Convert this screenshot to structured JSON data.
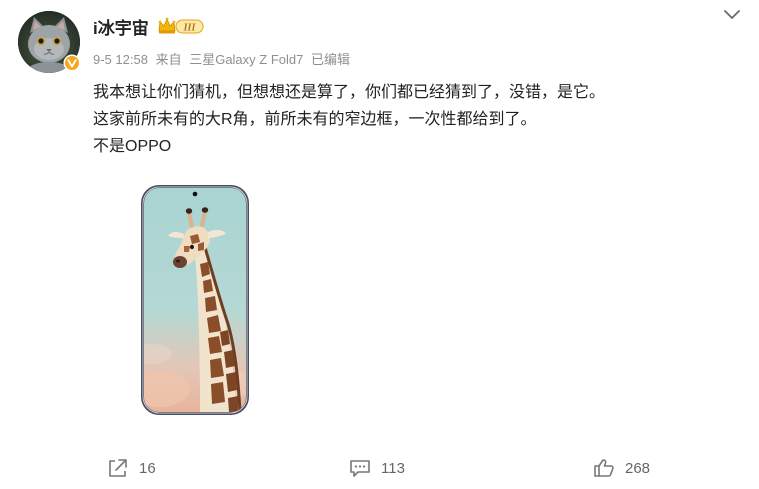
{
  "user": {
    "name": "i冰宇宙",
    "vip_level": "III",
    "avatar_icon": "gray-cat-avatar",
    "verify_icon": "verified-badge-icon"
  },
  "meta": {
    "time": "9-5 12:58",
    "source_prefix": "来自",
    "device": "三星Galaxy Z Fold7",
    "edited": "已编辑"
  },
  "post": {
    "lines": [
      "我本想让你们猜机，但想想还是算了，你们都已经猜到了，没错，是它。",
      "这家前所未有的大R角，前所未有的窄边框，一次性都给到了。",
      "不是OPPO"
    ],
    "image_icon": "phone-giraffe-wallpaper-image"
  },
  "actions": {
    "share_count": "16",
    "comment_count": "113",
    "like_count": "268"
  },
  "colors": {
    "text": "#222222",
    "meta": "#8f8f8f",
    "action": "#666666",
    "badge_orange": "#f5a623",
    "vip_gold": "#e8a317"
  }
}
